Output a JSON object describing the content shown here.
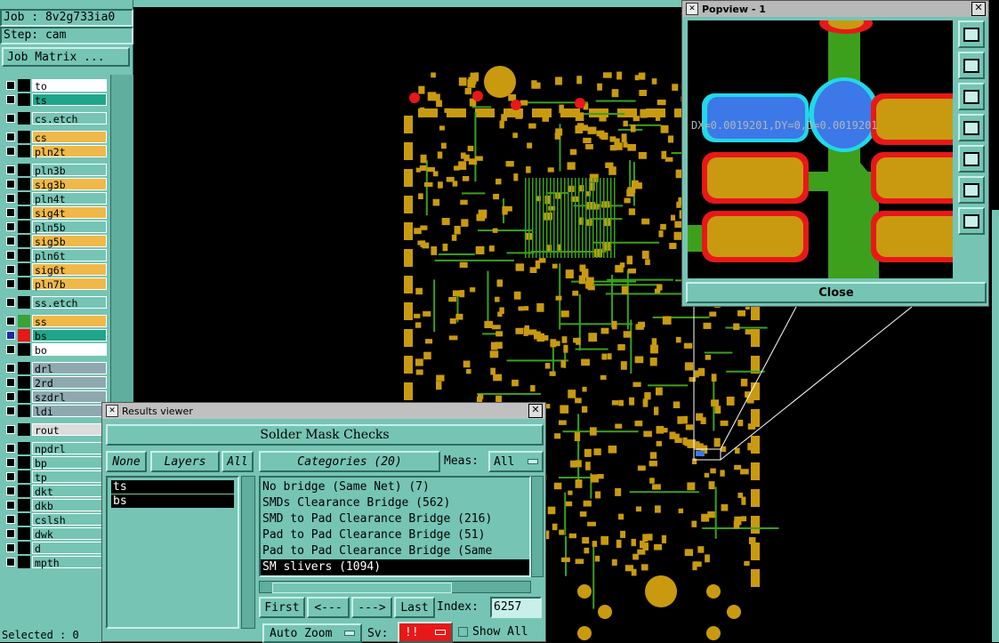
{
  "left_panel": {
    "job_label": "Job : 8v2g733ia0",
    "step_label": "Step: cam",
    "job_matrix_button": "Job Matrix ...",
    "selected_label": "Selected : 0",
    "layers": [
      {
        "name": "to",
        "color": "#ffffff",
        "sel": false,
        "swatch": "#000000"
      },
      {
        "name": "ts",
        "color": "#1fa58a",
        "sel": false,
        "swatch": "#000000"
      },
      {
        "name": "cs.etch",
        "color": "#76c4b4",
        "sel": false,
        "swatch": "#000000"
      },
      {
        "name": "cs",
        "color": "#f0b848",
        "sel": false,
        "swatch": "#000000"
      },
      {
        "name": "pln2t",
        "color": "#f0b848",
        "sel": false,
        "swatch": "#000000"
      },
      {
        "name": "pln3b",
        "color": "#76c4b4",
        "sel": false,
        "swatch": "#000000"
      },
      {
        "name": "sig3b",
        "color": "#f0b848",
        "sel": false,
        "swatch": "#000000"
      },
      {
        "name": "pln4t",
        "color": "#76c4b4",
        "sel": false,
        "swatch": "#000000"
      },
      {
        "name": "sig4t",
        "color": "#f0b848",
        "sel": false,
        "swatch": "#000000"
      },
      {
        "name": "pln5b",
        "color": "#76c4b4",
        "sel": false,
        "swatch": "#000000"
      },
      {
        "name": "sig5b",
        "color": "#f0b848",
        "sel": false,
        "swatch": "#000000"
      },
      {
        "name": "pln6t",
        "color": "#76c4b4",
        "sel": false,
        "swatch": "#000000"
      },
      {
        "name": "sig6t",
        "color": "#f0b848",
        "sel": false,
        "swatch": "#000000"
      },
      {
        "name": "pln7b",
        "color": "#f0b848",
        "sel": false,
        "swatch": "#000000"
      },
      {
        "name": "ss.etch",
        "color": "#76c4b4",
        "sel": false,
        "swatch": "#000000"
      },
      {
        "name": "ss",
        "color": "#f0b848",
        "sel": false,
        "swatch": "#3ca03c"
      },
      {
        "name": "bs",
        "color": "#1fa58a",
        "sel": true,
        "swatch": "#e81818"
      },
      {
        "name": "bo",
        "color": "#ffffff",
        "sel": false,
        "swatch": "#000000"
      },
      {
        "name": "drl",
        "color": "#8fa8b0",
        "sel": false,
        "swatch": "#000000"
      },
      {
        "name": "2rd",
        "color": "#8fa8b0",
        "sel": false,
        "swatch": "#000000"
      },
      {
        "name": "szdrl",
        "color": "#8fa8b0",
        "sel": false,
        "swatch": "#000000"
      },
      {
        "name": "ldi",
        "color": "#8fa8b0",
        "sel": false,
        "swatch": "#000000"
      },
      {
        "name": "rout",
        "color": "#dcdcdc",
        "sel": false,
        "swatch": "#000000"
      },
      {
        "name": "npdrl",
        "color": "#76c4b4",
        "sel": false,
        "swatch": "#000000"
      },
      {
        "name": "bp",
        "color": "#76c4b4",
        "sel": false,
        "swatch": "#000000"
      },
      {
        "name": "tp",
        "color": "#76c4b4",
        "sel": false,
        "swatch": "#000000"
      },
      {
        "name": "dkt",
        "color": "#76c4b4",
        "sel": false,
        "swatch": "#000000"
      },
      {
        "name": "dkb",
        "color": "#76c4b4",
        "sel": false,
        "swatch": "#000000"
      },
      {
        "name": "cslsh",
        "color": "#76c4b4",
        "sel": false,
        "swatch": "#000000"
      },
      {
        "name": "dwk",
        "color": "#76c4b4",
        "sel": false,
        "swatch": "#000000"
      },
      {
        "name": "d",
        "color": "#76c4b4",
        "sel": false,
        "swatch": "#000000"
      },
      {
        "name": "mpth",
        "color": "#76c4b4",
        "sel": false,
        "swatch": "#000000"
      }
    ]
  },
  "results_viewer": {
    "title": "Results viewer",
    "check_name": "Solder Mask Checks",
    "none_button": "None",
    "layers_button": "Layers",
    "all_button": "All",
    "categories_button": "Categories (20)",
    "meas_label": "Meas:",
    "meas_value": "All",
    "layer_items": [
      "ts",
      "bs"
    ],
    "categories": [
      "No bridge (Same Net) (7)",
      "SMDs Clearance Bridge (562)",
      "SMD to Pad Clearance Bridge (216)",
      "Pad to Pad Clearance Bridge (51)",
      "Pad to Pad Clearance Bridge (Same",
      "SM slivers (1094)"
    ],
    "first_button": "First",
    "prev_button": "<---",
    "next_button": "--->",
    "last_button": "Last",
    "index_label": "Index:",
    "index_value": "6257",
    "auto_zoom": "Auto Zoom",
    "sv_label": "Sv:",
    "sv_value": "!!",
    "show_all": "Show All"
  },
  "popview": {
    "title": "Popview - 1",
    "measure_text": "DX=0.0019201,DY=0,D=0.0019201",
    "close_button": "Close"
  },
  "colors": {
    "panel": "#76c4b4",
    "pad": "#c99a10",
    "trace": "#3ca01c",
    "blue": "#3c78e8",
    "red": "#e81818"
  }
}
